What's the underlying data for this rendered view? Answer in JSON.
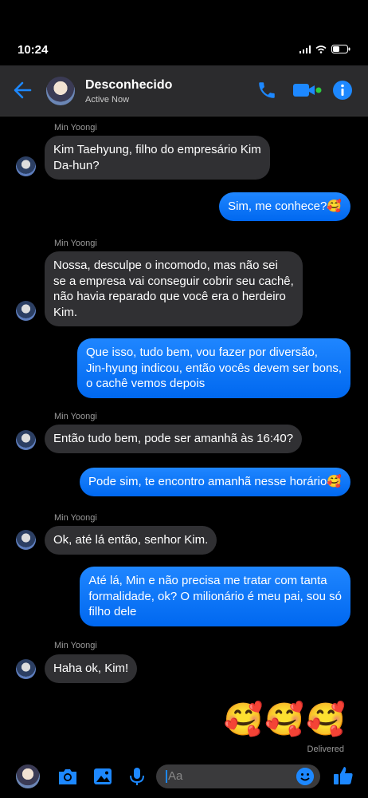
{
  "status_bar": {
    "time": "10:24"
  },
  "header": {
    "contact_name": "Desconhecido",
    "status": "Active Now"
  },
  "messages": [
    {
      "sender": "Min Yoongi",
      "text": "Kim Taehyung, filho do empresário Kim\nDa-hun?"
    },
    {
      "text": "Sim, me conhece?🥰"
    },
    {
      "sender": "Min Yoongi",
      "text": "Nossa, desculpe o incomodo, mas não sei\nse a empresa vai conseguir cobrir seu cachê,\nnão havia reparado que você era o herdeiro\nKim."
    },
    {
      "text": "Que isso, tudo bem, vou fazer por diversão,\nJin-hyung indicou, então vocês devem ser bons,\no cachê vemos depois"
    },
    {
      "sender": "Min Yoongi",
      "text": "Então tudo bem, pode ser amanhã às 16:40?"
    },
    {
      "text": "Pode sim, te encontro amanhã nesse horário🥰"
    },
    {
      "sender": "Min Yoongi",
      "text": "Ok, até lá então, senhor Kim."
    },
    {
      "text": "Até lá, Min e não precisa me tratar com tanta\nformalidade, ok? O milionário é meu pai, sou só\nfilho dele"
    },
    {
      "sender": "Min Yoongi",
      "text": "Haha ok, Kim!"
    },
    {
      "text": "🥰🥰🥰"
    }
  ],
  "delivery_status": "Delivered",
  "composer": {
    "placeholder": "Aa"
  },
  "colors": {
    "accent": "#1d88ff",
    "incoming_bubble": "#303033",
    "background": "#000000",
    "video_dot": "#2ecc40"
  },
  "icons": [
    "back-arrow-icon",
    "phone-icon",
    "video-icon",
    "info-icon",
    "camera-icon",
    "gallery-icon",
    "microphone-icon",
    "emoji-icon",
    "thumbs-up-icon"
  ]
}
